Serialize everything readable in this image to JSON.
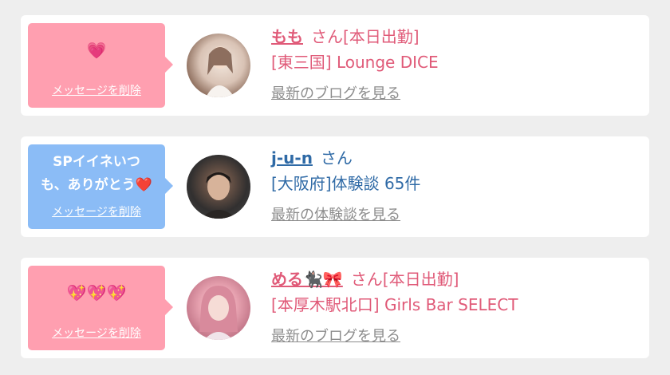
{
  "colors": {
    "pink_accent": "#e05a78",
    "blue_accent": "#2f6aa6",
    "bubble_pink": "#ff9fb0",
    "bubble_blue": "#8bbcf6",
    "link_gray": "#8c8c8c"
  },
  "cards": [
    {
      "message": "💗",
      "delete_label": "メッセージを削除",
      "name": "もも",
      "name_suffix": "さん[本日出勤]",
      "detail": "[東三国] Lounge DICE",
      "link_label": "最新のブログを見る",
      "icon": "avatar-photo"
    },
    {
      "message_line1": "SPイイネいつ",
      "message_line2": "も、ありがとう",
      "message_emoji": "❤️",
      "delete_label": "メッセージを削除",
      "name": "j-u-n",
      "name_suffix": "さん",
      "detail": "[大阪府]体験談 65件",
      "link_label": "最新の体験談を見る",
      "icon": "avatar-photo"
    },
    {
      "message": "💖💖💖",
      "delete_label": "メッセージを削除",
      "name": "める🐈‍⬛🎀",
      "name_suffix": "さん[本日出勤]",
      "detail": "[本厚木駅北口] Girls Bar SELECT",
      "link_label": "最新のブログを見る",
      "icon": "avatar-photo"
    }
  ]
}
